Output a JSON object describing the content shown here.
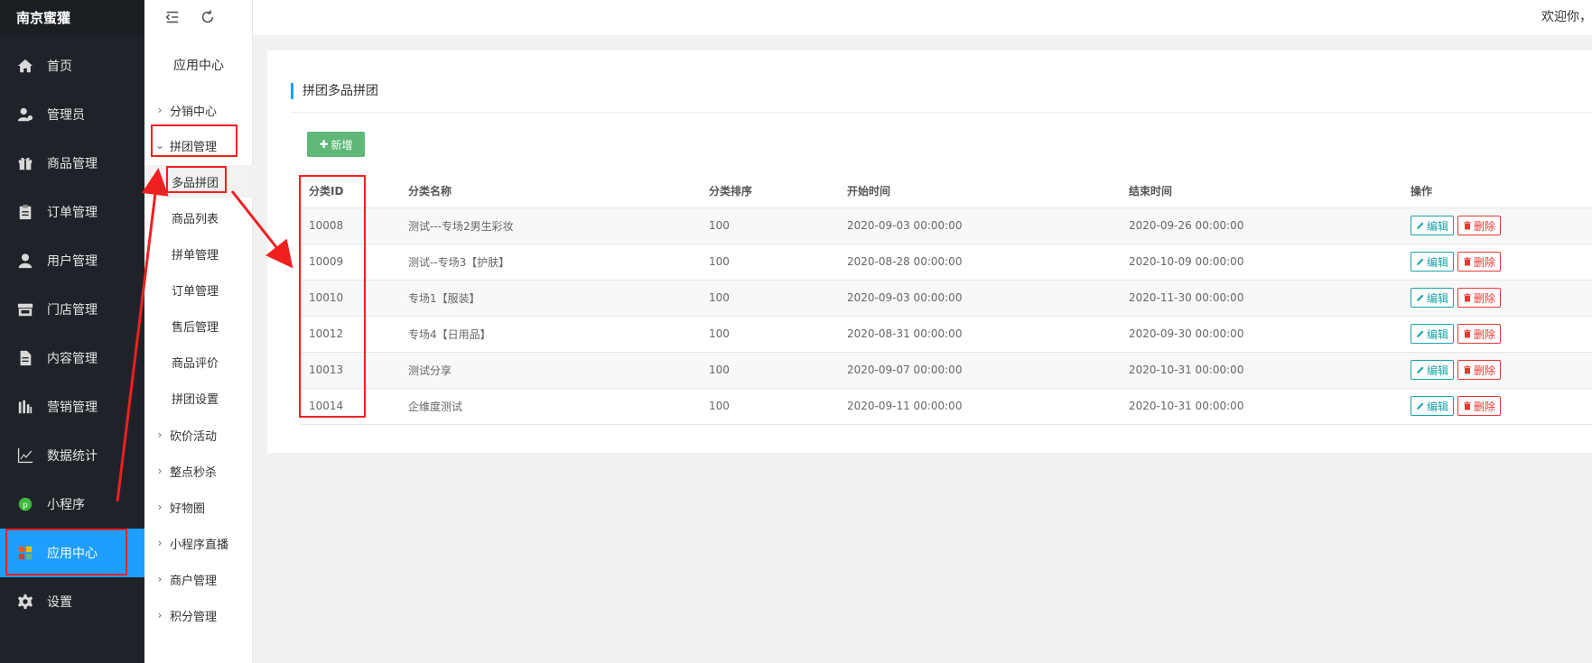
{
  "brand": "南京蜜獾",
  "sidebar": {
    "items": [
      {
        "label": "首页",
        "icon": "home-icon"
      },
      {
        "label": "管理员",
        "icon": "admin-user-icon"
      },
      {
        "label": "商品管理",
        "icon": "gift-icon"
      },
      {
        "label": "订单管理",
        "icon": "clipboard-icon"
      },
      {
        "label": "用户管理",
        "icon": "user-icon"
      },
      {
        "label": "门店管理",
        "icon": "store-icon"
      },
      {
        "label": "内容管理",
        "icon": "document-icon"
      },
      {
        "label": "营销管理",
        "icon": "bar-chart-icon"
      },
      {
        "label": "数据统计",
        "icon": "line-chart-icon"
      },
      {
        "label": "小程序",
        "icon": "mini-program-icon"
      },
      {
        "label": "应用中心",
        "icon": "apps-icon",
        "active": true
      },
      {
        "label": "设置",
        "icon": "gear-icon"
      }
    ]
  },
  "subnav": {
    "title": "应用中心",
    "groups": [
      {
        "label": "分销中心"
      },
      {
        "label": "拼团管理",
        "expanded": true
      },
      {
        "label": "砍价活动"
      },
      {
        "label": "整点秒杀"
      },
      {
        "label": "好物圈"
      },
      {
        "label": "小程序直播"
      },
      {
        "label": "商户管理"
      },
      {
        "label": "积分管理"
      }
    ],
    "children": [
      {
        "label": "多品拼团",
        "active": true
      },
      {
        "label": "商品列表"
      },
      {
        "label": "拼单管理"
      },
      {
        "label": "订单管理"
      },
      {
        "label": "售后管理"
      },
      {
        "label": "商品评价"
      },
      {
        "label": "拼团设置"
      }
    ]
  },
  "header": {
    "welcome": "欢迎你，"
  },
  "main": {
    "title": "拼团多品拼团",
    "add_label": "新增",
    "columns": [
      "分类ID",
      "分类名称",
      "分类排序",
      "开始时间",
      "结束时间",
      "操作"
    ],
    "edit_label": "编辑",
    "delete_label": "删除",
    "rows": [
      {
        "id": "10008",
        "name": "测试---专场2男生彩妆",
        "sort": "100",
        "start": "2020-09-03 00:00:00",
        "end": "2020-09-26 00:00:00"
      },
      {
        "id": "10009",
        "name": "测试--专场3【护肤】",
        "sort": "100",
        "start": "2020-08-28 00:00:00",
        "end": "2020-10-09 00:00:00"
      },
      {
        "id": "10010",
        "name": "专场1【服装】",
        "sort": "100",
        "start": "2020-09-03 00:00:00",
        "end": "2020-11-30 00:00:00"
      },
      {
        "id": "10012",
        "name": "专场4【日用品】",
        "sort": "100",
        "start": "2020-08-31 00:00:00",
        "end": "2020-09-30 00:00:00"
      },
      {
        "id": "10013",
        "name": "测试分享",
        "sort": "100",
        "start": "2020-09-07 00:00:00",
        "end": "2020-10-31 00:00:00"
      },
      {
        "id": "10014",
        "name": "企维度测试",
        "sort": "100",
        "start": "2020-09-11 00:00:00",
        "end": "2020-10-31 00:00:00"
      }
    ]
  },
  "colors": {
    "sidebar_bg": "#1f2329",
    "active_blue": "#1e9fff",
    "add_green": "#5fb878",
    "edit_teal": "#1aa1a8",
    "delete_red": "#e53935",
    "annotation_red": "#f02020"
  }
}
